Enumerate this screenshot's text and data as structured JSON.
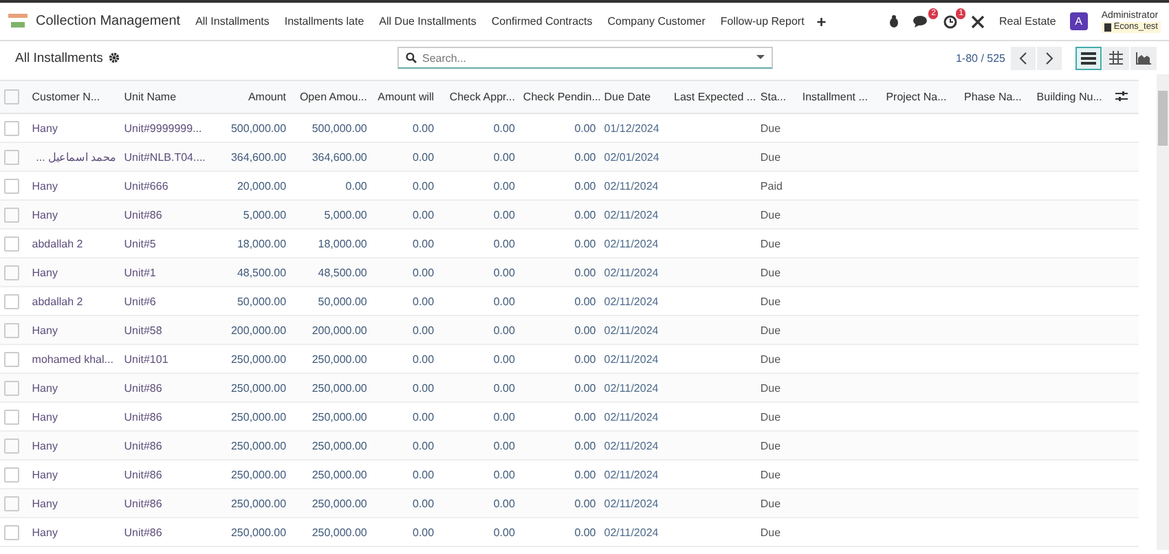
{
  "navbar": {
    "app_name": "Collection Management",
    "menu": [
      "All Installments",
      "Installments late",
      "All Due Installments",
      "Confirmed Contracts",
      "Company Customer",
      "Follow-up Report"
    ],
    "add_label": "+",
    "messages_badge": "2",
    "activities_badge": "1",
    "company_menu": "Real Estate",
    "avatar_letter": "A",
    "user_name": "Administrator",
    "database": "Econs_test"
  },
  "control_panel": {
    "title": "All Installments",
    "search": {
      "placeholder": "Search..."
    },
    "pager": "1-80 / 525",
    "views": [
      {
        "kind": "list",
        "selected": true
      },
      {
        "kind": "pivot",
        "selected": false
      },
      {
        "kind": "graph",
        "selected": false
      }
    ]
  },
  "table": {
    "select_all_checked": false,
    "columns": [
      "Customer N...",
      "Unit Name",
      "Amount",
      "Open Amou...",
      "Amount will",
      "Check Appr...",
      "Check Pendin...",
      "Due Date",
      "Last Expected ...",
      "Sta...",
      "Installment ...",
      "Project Na...",
      "Phase Na...",
      "Building Nu..."
    ],
    "rows": [
      {
        "customer": "Hany",
        "unit": "Unit#9999999...",
        "amount": "500,000.00",
        "open_amount": "500,000.00",
        "amount_will": "0.00",
        "check_approved": "0.00",
        "check_pending": "0.00",
        "due_date": "01/12/2024",
        "status": "Due",
        "checked": false
      },
      {
        "customer": "محمد اسماعيل ...",
        "unit": "Unit#NLB.T04....",
        "amount": "364,600.00",
        "open_amount": "364,600.00",
        "amount_will": "0.00",
        "check_approved": "0.00",
        "check_pending": "0.00",
        "due_date": "02/01/2024",
        "status": "Due",
        "checked": false
      },
      {
        "customer": "Hany",
        "unit": "Unit#666",
        "amount": "20,000.00",
        "open_amount": "0.00",
        "amount_will": "0.00",
        "check_approved": "0.00",
        "check_pending": "0.00",
        "due_date": "02/11/2024",
        "status": "Paid",
        "checked": false
      },
      {
        "customer": "Hany",
        "unit": "Unit#86",
        "amount": "5,000.00",
        "open_amount": "5,000.00",
        "amount_will": "0.00",
        "check_approved": "0.00",
        "check_pending": "0.00",
        "due_date": "02/11/2024",
        "status": "Due",
        "checked": false
      },
      {
        "customer": "abdallah 2",
        "unit": "Unit#5",
        "amount": "18,000.00",
        "open_amount": "18,000.00",
        "amount_will": "0.00",
        "check_approved": "0.00",
        "check_pending": "0.00",
        "due_date": "02/11/2024",
        "status": "Due",
        "checked": false
      },
      {
        "customer": "Hany",
        "unit": "Unit#1",
        "amount": "48,500.00",
        "open_amount": "48,500.00",
        "amount_will": "0.00",
        "check_approved": "0.00",
        "check_pending": "0.00",
        "due_date": "02/11/2024",
        "status": "Due",
        "checked": false
      },
      {
        "customer": "abdallah 2",
        "unit": "Unit#6",
        "amount": "50,000.00",
        "open_amount": "50,000.00",
        "amount_will": "0.00",
        "check_approved": "0.00",
        "check_pending": "0.00",
        "due_date": "02/11/2024",
        "status": "Due",
        "checked": false
      },
      {
        "customer": "Hany",
        "unit": "Unit#58",
        "amount": "200,000.00",
        "open_amount": "200,000.00",
        "amount_will": "0.00",
        "check_approved": "0.00",
        "check_pending": "0.00",
        "due_date": "02/11/2024",
        "status": "Due",
        "checked": false
      },
      {
        "customer": "mohamed khal...",
        "unit": "Unit#101",
        "amount": "250,000.00",
        "open_amount": "250,000.00",
        "amount_will": "0.00",
        "check_approved": "0.00",
        "check_pending": "0.00",
        "due_date": "02/11/2024",
        "status": "Due",
        "checked": false
      },
      {
        "customer": "Hany",
        "unit": "Unit#86",
        "amount": "250,000.00",
        "open_amount": "250,000.00",
        "amount_will": "0.00",
        "check_approved": "0.00",
        "check_pending": "0.00",
        "due_date": "02/11/2024",
        "status": "Due",
        "checked": false
      },
      {
        "customer": "Hany",
        "unit": "Unit#86",
        "amount": "250,000.00",
        "open_amount": "250,000.00",
        "amount_will": "0.00",
        "check_approved": "0.00",
        "check_pending": "0.00",
        "due_date": "02/11/2024",
        "status": "Due",
        "checked": false
      },
      {
        "customer": "Hany",
        "unit": "Unit#86",
        "amount": "250,000.00",
        "open_amount": "250,000.00",
        "amount_will": "0.00",
        "check_approved": "0.00",
        "check_pending": "0.00",
        "due_date": "02/11/2024",
        "status": "Due",
        "checked": false
      },
      {
        "customer": "Hany",
        "unit": "Unit#86",
        "amount": "250,000.00",
        "open_amount": "250,000.00",
        "amount_will": "0.00",
        "check_approved": "0.00",
        "check_pending": "0.00",
        "due_date": "02/11/2024",
        "status": "Due",
        "checked": false
      },
      {
        "customer": "Hany",
        "unit": "Unit#86",
        "amount": "250,000.00",
        "open_amount": "250,000.00",
        "amount_will": "0.00",
        "check_approved": "0.00",
        "check_pending": "0.00",
        "due_date": "02/11/2024",
        "status": "Due",
        "checked": false
      },
      {
        "customer": "Hany",
        "unit": "Unit#86",
        "amount": "250,000.00",
        "open_amount": "250,000.00",
        "amount_will": "0.00",
        "check_approved": "0.00",
        "check_pending": "0.00",
        "due_date": "02/11/2024",
        "status": "Due",
        "checked": false
      }
    ]
  }
}
